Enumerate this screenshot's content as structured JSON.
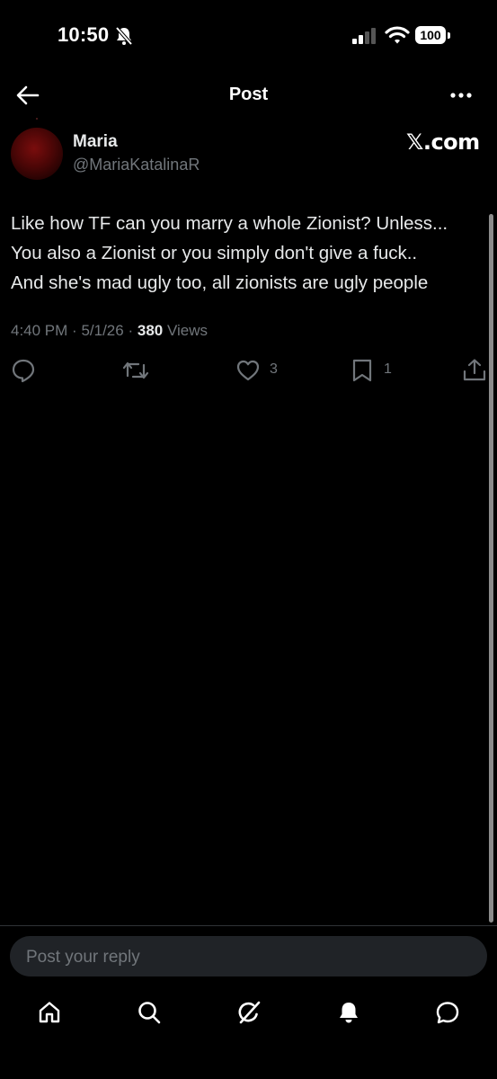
{
  "status_bar": {
    "time": "10:50",
    "battery": "100",
    "icons": [
      "bell-slash-icon",
      "cellular-signal-icon",
      "wifi-icon",
      "battery-icon"
    ]
  },
  "header": {
    "title": "Post",
    "left_icon": "back-arrow-icon",
    "right_icon": "more-options-icon"
  },
  "post": {
    "author": {
      "display_name": "Maria",
      "handle": "@MariaKatalinaR"
    },
    "watermark": "𝕏.com",
    "text": "Like how TF can you marry a whole Zionist? Unless...\nYou also a Zionist or you simply don't give a fuck..\nAnd she's mad ugly too, all zionists are ugly people",
    "time": "4:40 PM",
    "separator": "·",
    "date": "5/1/26",
    "views_count": "380",
    "views_label": "Views",
    "actions": {
      "reply": {
        "icon": "reply-icon",
        "count": ""
      },
      "repost": {
        "icon": "repost-icon",
        "count": ""
      },
      "like": {
        "icon": "heart-icon",
        "count": "3"
      },
      "bookmark": {
        "icon": "bookmark-icon",
        "count": "1"
      },
      "share": {
        "icon": "share-icon"
      }
    }
  },
  "reply": {
    "placeholder": "Post your reply"
  },
  "bottom_nav": [
    "home-icon",
    "search-icon",
    "grok-icon",
    "notifications-icon",
    "messages-icon"
  ],
  "colors": {
    "background": "#000000",
    "text": "#e7e9ea",
    "secondary_text": "#71767b",
    "reply_box": "#202327"
  }
}
